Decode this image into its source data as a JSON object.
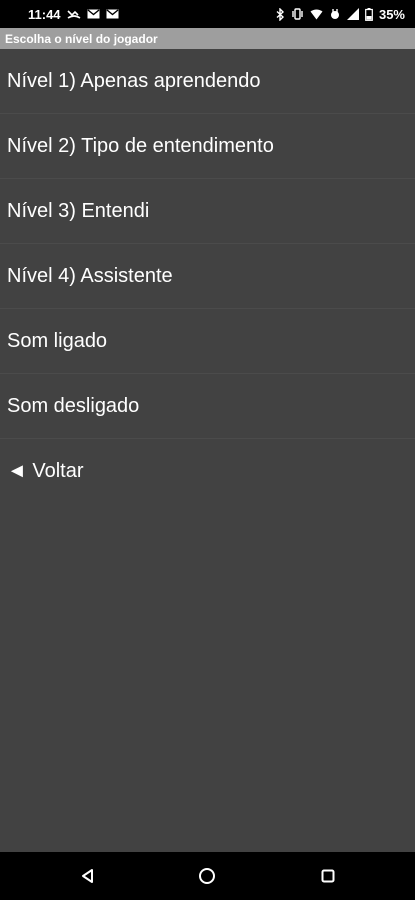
{
  "status_bar": {
    "time": "11:44",
    "battery": "35%",
    "icons": [
      "missed-call-icon",
      "mail-icon",
      "mail-icon",
      "bluetooth-icon",
      "vibrate-icon",
      "wifi-icon",
      "data-icon",
      "signal-icon",
      "battery-icon"
    ]
  },
  "title": "Escolha o nível do jogador",
  "menu": {
    "items": [
      {
        "label": "Nível 1) Apenas aprendendo"
      },
      {
        "label": "Nível 2) Tipo de entendimento"
      },
      {
        "label": "Nível 3) Entendi"
      },
      {
        "label": "Nível 4) Assistente"
      },
      {
        "label": "Som ligado"
      },
      {
        "label": "Som desligado"
      },
      {
        "label": "◄ Voltar"
      }
    ]
  },
  "nav_bar": {
    "icons": [
      "back-icon",
      "home-icon",
      "recents-icon"
    ]
  },
  "colors": {
    "background": "#424242",
    "title_bar": "#9e9e9e",
    "text": "#ffffff",
    "system_bars": "#000000"
  }
}
